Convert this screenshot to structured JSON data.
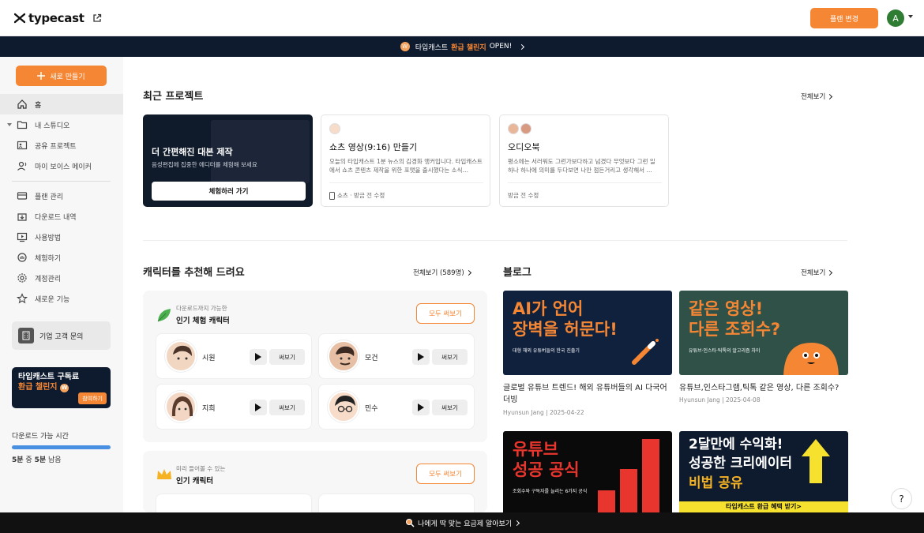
{
  "header": {
    "logo_text": "typecast",
    "plan_button": "플랜 변경",
    "avatar_initial": "A"
  },
  "banner": {
    "coin": "W",
    "prefix": "타입캐스트",
    "highlight": "환급 챌린지",
    "suffix": "OPEN!"
  },
  "sidebar": {
    "new_button": "새로 만들기",
    "items": [
      {
        "label": "홈",
        "icon": "home-icon"
      },
      {
        "label": "내 스튜디오",
        "icon": "folder-icon"
      },
      {
        "label": "공유 프로젝트",
        "icon": "shared-project-icon"
      },
      {
        "label": "마이 보이스 메이커",
        "icon": "voice-maker-icon"
      },
      {
        "label": "플랜 관리",
        "icon": "credit-card-icon"
      },
      {
        "label": "다운로드 내역",
        "icon": "download-history-icon"
      },
      {
        "label": "사용방법",
        "icon": "tutorial-icon"
      },
      {
        "label": "체험하기",
        "icon": "trial-hand-icon"
      },
      {
        "label": "계정관리",
        "icon": "gear-icon"
      },
      {
        "label": "새로운 기능",
        "icon": "star-icon"
      }
    ],
    "business_inquiry": "기업 고객 문의",
    "promo": {
      "line1": "타입캐스트 구독료",
      "line2": "환급 챌린지",
      "coin": "W",
      "join": "참여하기"
    },
    "download": {
      "label": "다운로드 가능 시간",
      "remaining_a": "5분",
      "middle": "중",
      "remaining_b": "5분",
      "suffix": "남음",
      "fraction": 1.0
    }
  },
  "recent": {
    "title": "최근 프로젝트",
    "see_all": "전체보기",
    "editor_card": {
      "title": "더 간편해진 대본 제작",
      "subtitle": "음성편집에 집중한 에디터를 체험해 보세요",
      "button": "체험하러 가기"
    },
    "projects": [
      {
        "title": "쇼츠 영상(9:16) 만들기",
        "desc": "오늘의 타입캐스트 1분 뉴스의 김경화 앵커입니다. 타입캐스트에서 쇼츠 콘텐츠 제작을 위한 포맷을 출시했다는 소식…",
        "meta": "쇼츠 · 방금 전 수정"
      },
      {
        "title": "오디오북",
        "desc": "평소에는 서러워도 그런가보다하고 넘겼다 무엇보다 그런 일 하나 하나에 의미를 두다보면 나만 점든거리고 생각해서 …",
        "meta": "방금 전 수정"
      }
    ]
  },
  "characters": {
    "title": "캐릭터를 추천해 드려요",
    "see_all": "전체보기 (589명)",
    "groups": [
      {
        "small": "다운로드까지 가능한",
        "title": "인기 체험 캐릭터",
        "use_all": "모두 써보기",
        "voices": [
          {
            "name": "시원",
            "use": "써보기"
          },
          {
            "name": "모건",
            "use": "써보기"
          },
          {
            "name": "지희",
            "use": "써보기"
          },
          {
            "name": "민수",
            "use": "써보기"
          }
        ]
      },
      {
        "small": "미리 들어볼 수 있는",
        "title": "인기 캐릭터",
        "use_all": "모두 써보기"
      }
    ]
  },
  "blog": {
    "title": "블로그",
    "see_all": "전체보기",
    "posts": [
      {
        "thumb_line1": "AI가 언어",
        "thumb_line2": "장벽을 허문다!",
        "thumb_sub": "대형 해외 유튜버들의 한국 진출기",
        "title": "글로벌 유튜브 트렌드! 해외 유튜버들의 AI 다국어 더빙",
        "meta": "Hyunsun Jang | 2025-04-22",
        "bg": "#10213d",
        "fg": "#f48634"
      },
      {
        "thumb_line1": "같은 영상!",
        "thumb_line2": "다른 조회수?",
        "thumb_sub": "유튜브·인스타·틱톡의 알고리즘 차이",
        "title": "유튜브,인스타그램,틱톡 같은 영상, 다른 조회수?",
        "meta": "Hyunsun Jang | 2025-04-08",
        "bg": "#2f5148",
        "fg": "#f48634"
      },
      {
        "thumb_line1": "유튜브",
        "thumb_line2": "성공 공식",
        "thumb_sub": "조회수와 구독자를 늘리는 6가지 공식",
        "bg": "#0a0a0a",
        "fg": "#e8352d"
      },
      {
        "thumb_line1": "2달만에 수익화!",
        "thumb_line2": "성공한 크리에이터",
        "thumb_line3": "비법 공유",
        "thumb_sub": "타입캐스트 환급 혜택 받기>",
        "bg": "#0e1b2f",
        "fg": "#ffffff"
      }
    ]
  },
  "bottom_bar": {
    "text": "나에게 딱 맞는 요금제 알아보기"
  },
  "help": "?"
}
